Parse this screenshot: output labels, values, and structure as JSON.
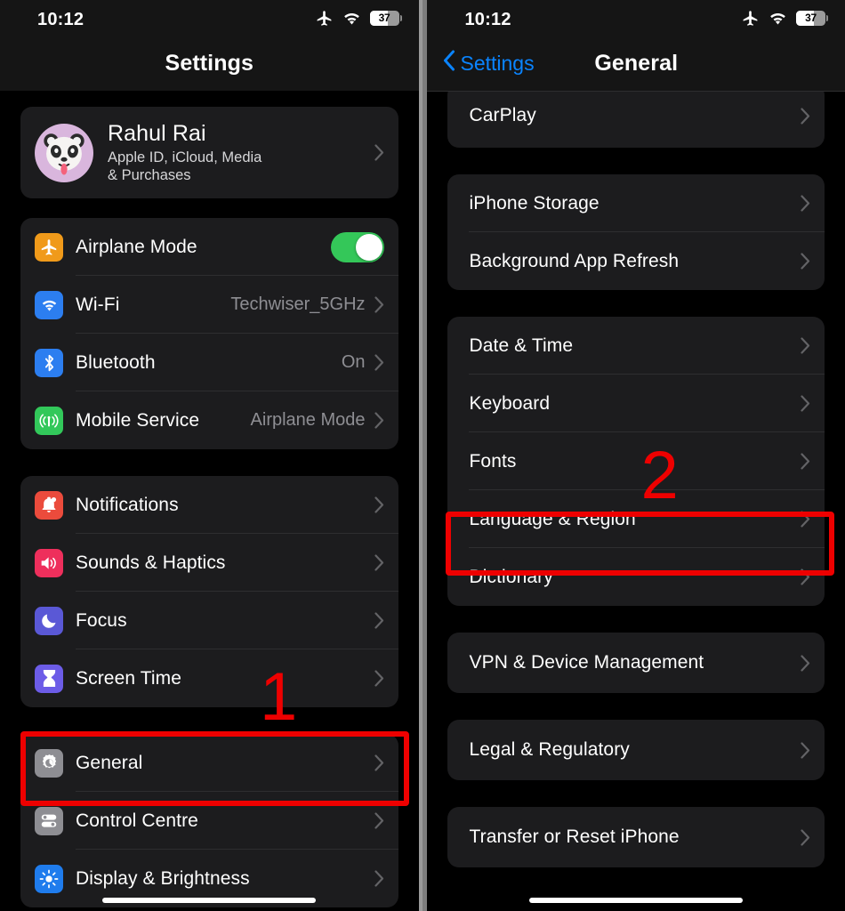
{
  "left_phone": {
    "status_bar": {
      "time": "10:12",
      "airplane_icon": "airplane-icon",
      "wifi_icon": "wifi-icon",
      "battery_level": "37"
    },
    "nav": {
      "title": "Settings"
    },
    "profile": {
      "name": "Rahul Rai",
      "subtitle_line1": "Apple ID, iCloud, Media",
      "subtitle_line2": "& Purchases",
      "avatar_icon": "panda-memoji-avatar",
      "avatar_bg": "#d9b6dd"
    },
    "group_connectivity": [
      {
        "label": "Airplane Mode",
        "icon": "airplane-icon",
        "icon_bg": "#f09a1a",
        "control": "toggle",
        "toggle_on": true
      },
      {
        "label": "Wi-Fi",
        "icon": "wifi-icon",
        "icon_bg": "#2c7ef0",
        "value": "Techwiser_5GHz",
        "control": "chevron"
      },
      {
        "label": "Bluetooth",
        "icon": "bluetooth-icon",
        "icon_bg": "#2c7ef0",
        "value": "On",
        "control": "chevron"
      },
      {
        "label": "Mobile Service",
        "icon": "antenna-icon",
        "icon_bg": "#32c85a",
        "value": "Airplane Mode",
        "control": "chevron"
      }
    ],
    "group_alerts": [
      {
        "label": "Notifications",
        "icon": "bell-icon",
        "icon_bg": "#eb4b3c",
        "control": "chevron"
      },
      {
        "label": "Sounds & Haptics",
        "icon": "speaker-icon",
        "icon_bg": "#ee2f5c",
        "control": "chevron"
      },
      {
        "label": "Focus",
        "icon": "moon-icon",
        "icon_bg": "#5a58d6",
        "control": "chevron"
      },
      {
        "label": "Screen Time",
        "icon": "hourglass-icon",
        "icon_bg": "#6c5ce7",
        "control": "chevron"
      }
    ],
    "group_system": [
      {
        "label": "General",
        "icon": "gear-icon",
        "icon_bg": "#8e8e93",
        "control": "chevron",
        "highlighted": true
      },
      {
        "label": "Control Centre",
        "icon": "sliders-icon",
        "icon_bg": "#8e8e93",
        "control": "chevron"
      },
      {
        "label": "Display & Brightness",
        "icon": "brightness-icon",
        "icon_bg": "#1f7ced",
        "control": "chevron"
      }
    ],
    "annotation": {
      "number": "1",
      "highlight_color": "#ee0000"
    }
  },
  "right_phone": {
    "status_bar": {
      "time": "10:12",
      "airplane_icon": "airplane-icon",
      "wifi_icon": "wifi-icon",
      "battery_level": "37"
    },
    "nav": {
      "back_label": "Settings",
      "title": "General",
      "back_icon": "chevron-left-icon"
    },
    "group_carplay": [
      {
        "label": "CarPlay",
        "control": "chevron"
      }
    ],
    "group_storage": [
      {
        "label": "iPhone Storage",
        "control": "chevron"
      },
      {
        "label": "Background App Refresh",
        "control": "chevron"
      }
    ],
    "group_locale": [
      {
        "label": "Date & Time",
        "control": "chevron"
      },
      {
        "label": "Keyboard",
        "control": "chevron"
      },
      {
        "label": "Fonts",
        "control": "chevron"
      },
      {
        "label": "Language & Region",
        "control": "chevron",
        "highlighted": true
      },
      {
        "label": "Dictionary",
        "control": "chevron"
      }
    ],
    "group_vpn": [
      {
        "label": "VPN & Device Management",
        "control": "chevron"
      }
    ],
    "group_legal": [
      {
        "label": "Legal & Regulatory",
        "control": "chevron"
      }
    ],
    "group_reset": [
      {
        "label": "Transfer or Reset iPhone",
        "control": "chevron"
      }
    ],
    "annotation": {
      "number": "2",
      "highlight_color": "#ee0000"
    }
  }
}
